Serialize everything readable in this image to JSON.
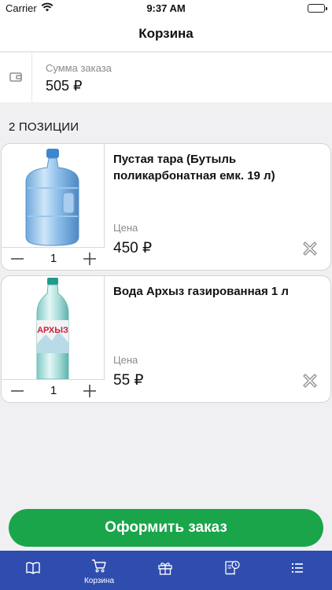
{
  "status_bar": {
    "carrier": "Carrier",
    "time": "9:37 AM"
  },
  "header": {
    "title": "Корзина"
  },
  "summary": {
    "icon": "wallet-icon",
    "label": "Сумма заказа",
    "value": "505 ₽"
  },
  "items_header": "2 ПОЗИЦИИ",
  "items": [
    {
      "name": "Пустая тара (Бутыль поликарбонатная емк. 19 л)",
      "price_label": "Цена",
      "price": "450 ₽",
      "quantity": "1",
      "image": "water-bottle-19l-image"
    },
    {
      "name": "Вода Архыз газированная 1 л",
      "price_label": "Цена",
      "price": "55 ₽",
      "quantity": "1",
      "image": "arkhyz-bottle-image",
      "brand_text": "АРХЫЗ"
    }
  ],
  "checkout_button": "Оформить заказ",
  "tabs": [
    {
      "icon": "catalog-book-icon",
      "label": ""
    },
    {
      "icon": "cart-icon",
      "label": "Корзина",
      "active": true
    },
    {
      "icon": "gift-icon",
      "label": ""
    },
    {
      "icon": "order-history-icon",
      "label": ""
    },
    {
      "icon": "menu-list-icon",
      "label": ""
    }
  ],
  "colors": {
    "accent_green": "#1aa54b",
    "tab_bar_blue": "#2f4dae",
    "background": "#f0f0f2"
  }
}
